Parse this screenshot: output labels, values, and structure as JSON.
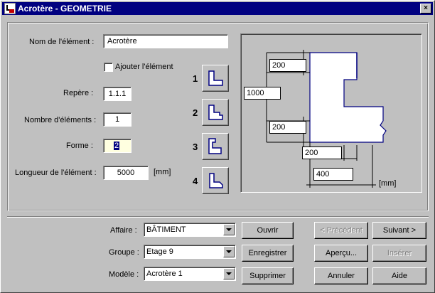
{
  "window": {
    "title": "Acrotère - GEOMETRIE",
    "close_glyph": "×"
  },
  "form": {
    "nom_label": "Nom de l'élément :",
    "nom_value": "Acrotère",
    "ajouter_label": "Ajouter l'élément",
    "ajouter_checked": false,
    "repere_label": "Repère :",
    "repere_value": "1.1.1",
    "nombre_label": "Nombre d'éléments :",
    "nombre_value": "1",
    "forme_label": "Forme :",
    "forme_value": "2",
    "longueur_label": "Longueur de l'élément :",
    "longueur_value": "5000",
    "longueur_unit": "[mm]"
  },
  "shapes": [
    {
      "number": "1",
      "icon": "shape-l-icon"
    },
    {
      "number": "2",
      "icon": "shape-l-notch-icon"
    },
    {
      "number": "3",
      "icon": "shape-l-tall-icon"
    },
    {
      "number": "4",
      "icon": "shape-l-chamfer-icon"
    }
  ],
  "diagram": {
    "dim_top": "200",
    "dim_height": "1000",
    "dim_bottom": "200",
    "dim_width_top": "200",
    "dim_width_bottom": "400",
    "unit": "[mm]"
  },
  "bottom": {
    "affaire_label": "Affaire :",
    "affaire_value": "BÂTIMENT",
    "groupe_label": "Groupe :",
    "groupe_value": "Etage 9",
    "modele_label": "Modèle :",
    "modele_value": "Acrotère 1"
  },
  "buttons": {
    "ouvrir": "Ouvrir",
    "enregistrer": "Enregistrer",
    "supprimer": "Supprimer",
    "precedent": "< Précédent",
    "suivant": "Suivant >",
    "apercu": "Aperçu...",
    "inserer": "Insérer",
    "annuler": "Annuler",
    "aide": "Aide"
  },
  "colors": {
    "titlebar": "#000080",
    "face": "#c0c0c0",
    "shape_stroke": "#000080"
  }
}
